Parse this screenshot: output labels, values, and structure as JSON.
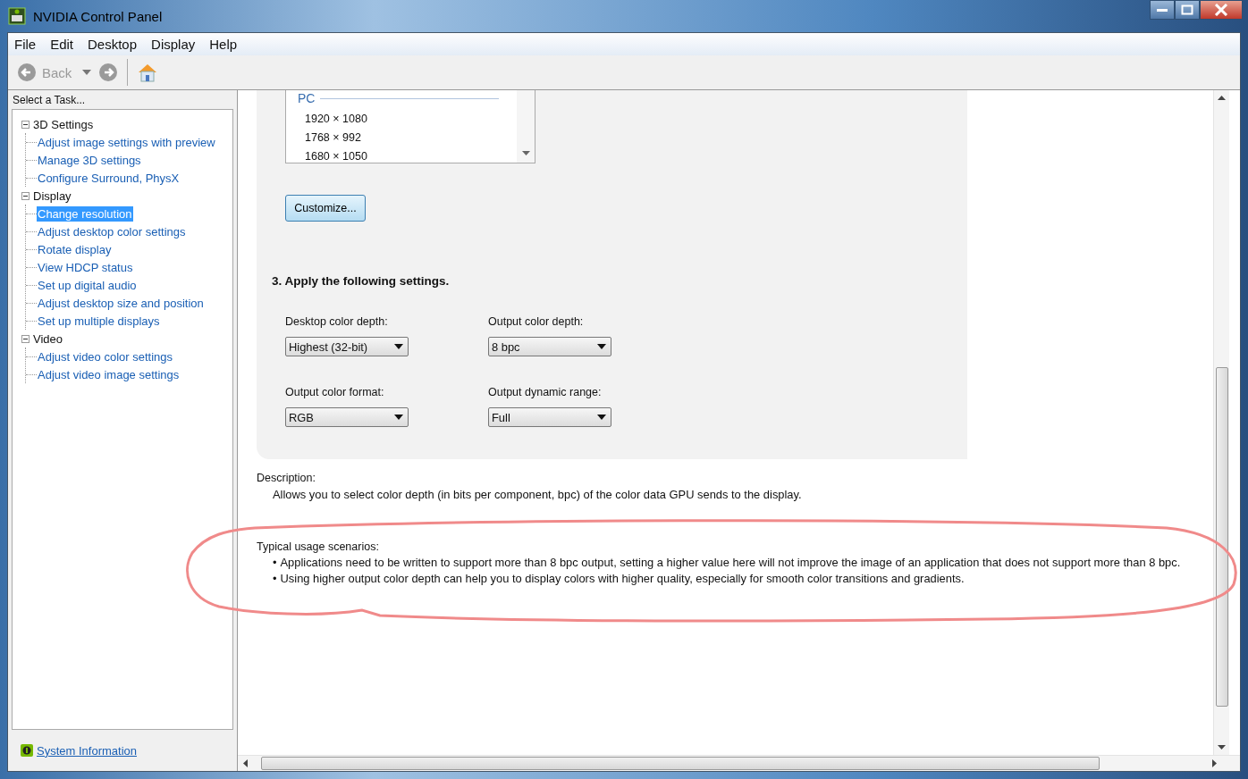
{
  "window": {
    "title": "NVIDIA Control Panel"
  },
  "menu": [
    "File",
    "Edit",
    "Desktop",
    "Display",
    "Help"
  ],
  "toolbar": {
    "back_label": "Back"
  },
  "sidebar": {
    "heading": "Select a Task...",
    "tree": [
      {
        "label": "3D Settings",
        "expanded": true,
        "children": [
          {
            "label": "Adjust image settings with preview",
            "selected": false
          },
          {
            "label": "Manage 3D settings",
            "selected": false
          },
          {
            "label": "Configure Surround, PhysX",
            "selected": false
          }
        ]
      },
      {
        "label": "Display",
        "expanded": true,
        "children": [
          {
            "label": "Change resolution",
            "selected": true
          },
          {
            "label": "Adjust desktop color settings",
            "selected": false
          },
          {
            "label": "Rotate display",
            "selected": false
          },
          {
            "label": "View HDCP status",
            "selected": false
          },
          {
            "label": "Set up digital audio",
            "selected": false
          },
          {
            "label": "Adjust desktop size and position",
            "selected": false
          },
          {
            "label": "Set up multiple displays",
            "selected": false
          }
        ]
      },
      {
        "label": "Video",
        "expanded": true,
        "children": [
          {
            "label": "Adjust video color settings",
            "selected": false
          },
          {
            "label": "Adjust video image settings",
            "selected": false
          }
        ]
      }
    ],
    "footer_link": "System Information"
  },
  "resolution_list": {
    "group": "PC",
    "items": [
      "1920 × 1080",
      "1768 × 992",
      "1680 × 1050"
    ]
  },
  "customize_button": "Customize...",
  "step_heading": "3. Apply the following settings.",
  "settings": [
    {
      "label": "Desktop color depth:",
      "value": "Highest (32-bit)"
    },
    {
      "label": "Output color depth:",
      "value": "8 bpc"
    },
    {
      "label": "Output color format:",
      "value": "RGB"
    },
    {
      "label": "Output dynamic range:",
      "value": "Full"
    }
  ],
  "description": {
    "heading": "Description:",
    "text": "Allows you to select color depth (in bits per component, bpc) of the color data GPU sends to the display."
  },
  "usage": {
    "heading": "Typical usage scenarios:",
    "bullets": [
      {
        "marker": "•",
        "text": "Applications need to be written to support more than 8 bpc output, setting a higher value here will not improve the image of an application that does not support more than 8 bpc."
      },
      {
        "marker": "•",
        "text": "Using higher output color depth can help you to display colors with higher quality, especially for smooth color transitions and gradients."
      }
    ]
  }
}
